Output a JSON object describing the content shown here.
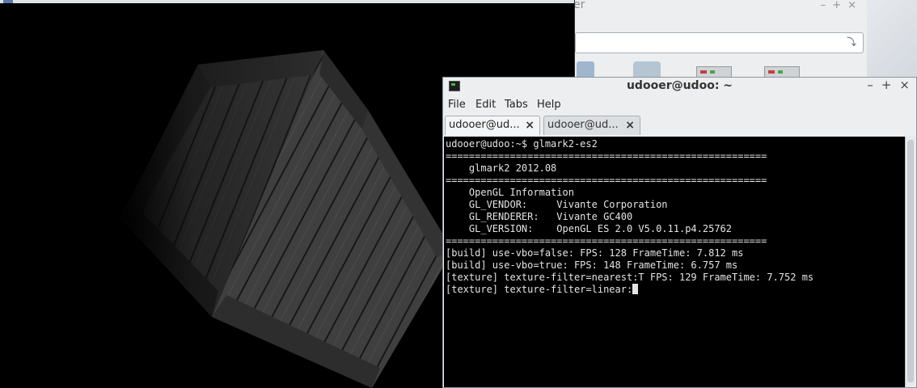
{
  "file_manager": {
    "title_fragment": "er",
    "controls": [
      "–",
      "+",
      "×"
    ],
    "go_icon": "go-arrow-icon"
  },
  "glmark_window": {
    "scene": "textured wooden crate (cube) rendered in 3D"
  },
  "terminal": {
    "title": "udooer@udoo: ~",
    "controls": [
      "–",
      "+",
      "×"
    ],
    "menu": [
      "File",
      "Edit",
      "Tabs",
      "Help"
    ],
    "tabs": [
      {
        "label": "udooer@ud...",
        "close": "×",
        "active": true
      },
      {
        "label": "udooer@ud...",
        "close": "×",
        "active": false
      }
    ],
    "lines": [
      "udooer@udoo:~$ glmark2-es2",
      "=======================================================",
      "    glmark2 2012.08",
      "=======================================================",
      "    OpenGL Information",
      "    GL_VENDOR:     Vivante Corporation",
      "    GL_RENDERER:   Vivante GC400",
      "    GL_VERSION:    OpenGL ES 2.0 V5.0.11.p4.25762",
      "=======================================================",
      "[build] use-vbo=false: FPS: 128 FrameTime: 7.812 ms",
      "[build] use-vbo=true: FPS: 148 FrameTime: 6.757 ms",
      "[texture] texture-filter=nearest:T FPS: 129 FrameTime: 7.752 ms",
      "[texture] texture-filter=linear:"
    ]
  }
}
